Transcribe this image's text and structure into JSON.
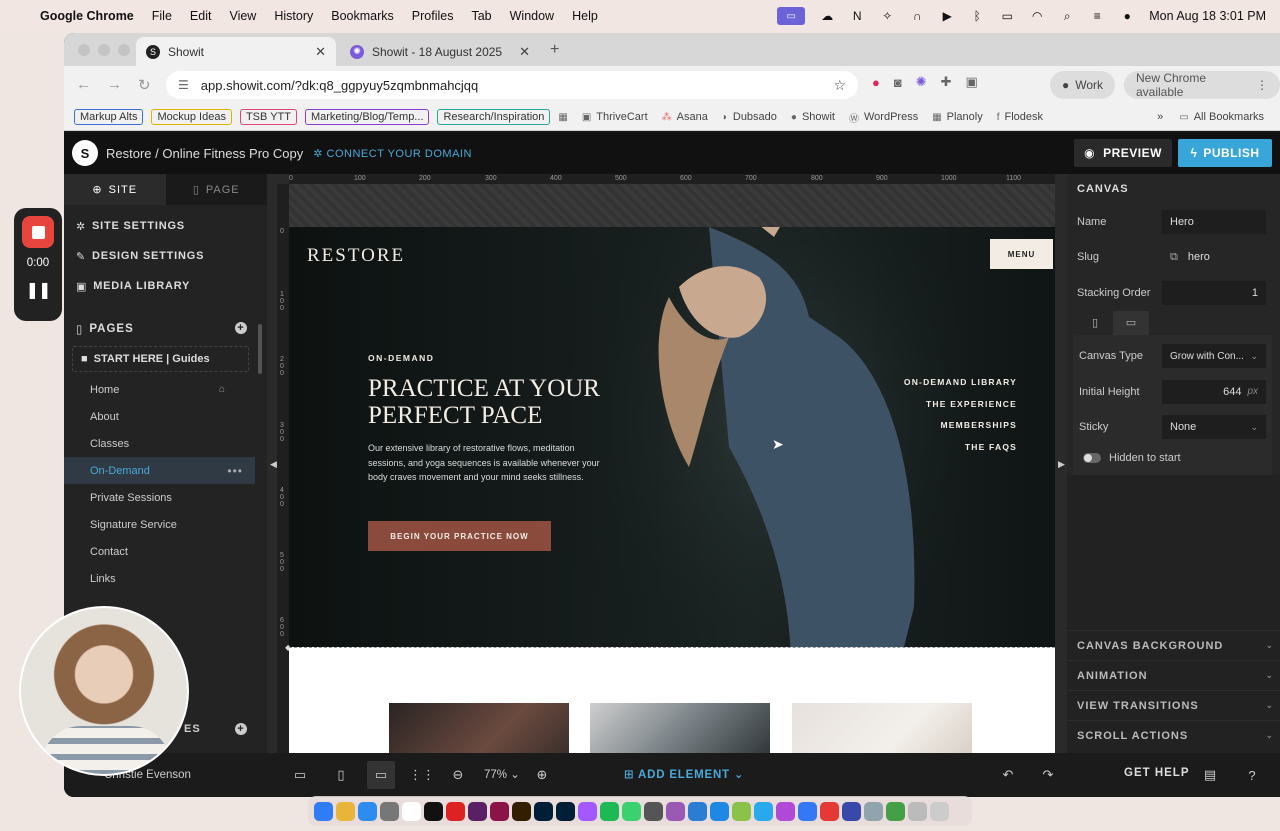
{
  "menubar": {
    "app": "Google Chrome",
    "items": [
      "File",
      "Edit",
      "View",
      "History",
      "Bookmarks",
      "Profiles",
      "Tab",
      "Window",
      "Help"
    ],
    "datetime": "Mon Aug 18  3:01 PM"
  },
  "tabs": [
    {
      "title": "Showit",
      "active": true
    },
    {
      "title": "Showit - 18 August 2025",
      "active": false
    }
  ],
  "omnibox": {
    "url": "app.showit.com/?dk:q8_ggpyuy5zqmbnmahcjqq"
  },
  "profile": {
    "label": "Work"
  },
  "update": {
    "label": "New Chrome available"
  },
  "bookmarks": {
    "boxed": [
      {
        "label": "Markup Alts",
        "color": "#3b6fd6"
      },
      {
        "label": "Mockup Ideas",
        "color": "#e0b400"
      },
      {
        "label": "TSB YTT",
        "color": "#e0457a"
      },
      {
        "label": "Marketing/Blog/Temp...",
        "color": "#8a3fd1"
      },
      {
        "label": "Research/Inspiration",
        "color": "#2aa79b"
      }
    ],
    "links": [
      "ThriveCart",
      "Asana",
      "Dubsado",
      "Showit",
      "WordPress",
      "Planoly",
      "Flodesk"
    ],
    "all_label": "All Bookmarks"
  },
  "app": {
    "site_name": "Restore / Online Fitness Pro Copy",
    "connect_domain": "CONNECT YOUR DOMAIN",
    "preview": "PREVIEW",
    "publish": "PUBLISH"
  },
  "sidebar": {
    "tab_site": "SITE",
    "tab_page": "PAGE",
    "site_settings": "SITE SETTINGS",
    "design_settings": "DESIGN SETTINGS",
    "media_library": "MEDIA LIBRARY",
    "pages_label": "PAGES",
    "folder": "START HERE | Guides",
    "pages": [
      "Home",
      "About",
      "Classes",
      "On-Demand",
      "Private Sessions",
      "Signature Service",
      "Contact",
      "Links"
    ],
    "active_page": "On-Demand",
    "styles_label": "ES"
  },
  "ruler": {
    "top": [
      "0",
      "100",
      "200",
      "300",
      "400",
      "500",
      "600",
      "700",
      "800",
      "900",
      "1000",
      "1100"
    ],
    "left": [
      "0",
      "100",
      "200",
      "300",
      "400",
      "500",
      "600"
    ]
  },
  "hero": {
    "brand": "RESTORE",
    "menu": "MENU",
    "eyebrow": "ON-DEMAND",
    "title": "PRACTICE AT YOUR PERFECT PACE",
    "body": "Our extensive library of restorative flows, meditation sessions, and yoga sequences is available whenever your body craves movement and your mind seeks stillness.",
    "cta": "BEGIN YOUR PRACTICE NOW",
    "nav": [
      "ON-DEMAND LIBRARY",
      "THE EXPERIENCE",
      "MEMBERSHIPS",
      "THE FAQS"
    ]
  },
  "canvas_panel": {
    "title": "CANVAS",
    "name_label": "Name",
    "name_value": "Hero",
    "slug_label": "Slug",
    "slug_value": "hero",
    "stacking_label": "Stacking Order",
    "stacking_value": "1",
    "canvas_type_label": "Canvas Type",
    "canvas_type_value": "Grow with Con...",
    "initial_height_label": "Initial Height",
    "initial_height_value": "644",
    "initial_height_unit": "px",
    "sticky_label": "Sticky",
    "sticky_value": "None",
    "hidden_label": "Hidden to start",
    "sections": [
      "CANVAS BACKGROUND",
      "ANIMATION",
      "VIEW TRANSITIONS",
      "SCROLL ACTIONS"
    ]
  },
  "footer": {
    "user": "Christie Evenson",
    "zoom": "77%",
    "add_element": "ADD ELEMENT",
    "get_help": "GET HELP"
  },
  "recorder": {
    "time": "0:00"
  }
}
